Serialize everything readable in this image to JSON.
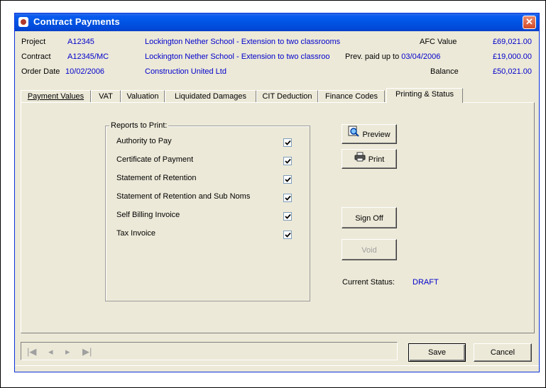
{
  "window": {
    "title": "Contract Payments",
    "close_glyph": "✕"
  },
  "header": {
    "project": {
      "label": "Project",
      "code": "A12345",
      "description": "Lockington Nether School - Extension to two classrooms",
      "value_label": "AFC Value",
      "value": "£69,021.00"
    },
    "contract": {
      "label": "Contract",
      "code": "A12345/MC",
      "description": "Lockington Nether School - Extension to two classroo",
      "value_label_prefix": "Prev. paid up to ",
      "value_label_date": "03/04/2006",
      "value": "£19,000.00"
    },
    "order": {
      "label": "Order Date",
      "date": "10/02/2006",
      "description": "Construction United Ltd",
      "value_label": "Balance",
      "value": "£50,021.00"
    }
  },
  "tabs": [
    {
      "label": "Payment Values",
      "active": false
    },
    {
      "label": "VAT",
      "active": false
    },
    {
      "label": "Valuation",
      "active": false
    },
    {
      "label": "Liquidated Damages",
      "active": false
    },
    {
      "label": "CIT Deduction",
      "active": false
    },
    {
      "label": "Finance Codes",
      "active": false
    },
    {
      "label": "Printing & Status",
      "active": true
    }
  ],
  "reports": {
    "group_label": "Reports to Print:",
    "items": [
      {
        "label": "Authority to Pay",
        "checked": true
      },
      {
        "label": "Certificate of Payment",
        "checked": true
      },
      {
        "label": "Statement of Retention",
        "checked": true
      },
      {
        "label": "Statement of Retention and Sub Noms",
        "checked": true
      },
      {
        "label": "Self Billing Invoice",
        "checked": true
      },
      {
        "label": "Tax Invoice",
        "checked": true
      }
    ]
  },
  "buttons": {
    "preview": "Preview",
    "print": "Print",
    "sign_off": "Sign Off",
    "void": "Void",
    "save": "Save",
    "cancel": "Cancel"
  },
  "status": {
    "label": "Current Status:",
    "value": "DRAFT"
  },
  "navigator": {
    "first": "|◀",
    "prev": "◂",
    "next": "▸",
    "last": "▶|"
  },
  "icons": [
    "app-icon",
    "close-icon",
    "preview-icon",
    "print-icon",
    "checkbox-check-icon"
  ],
  "colors": {
    "title_bar": "#0054e3",
    "link_text": "#0000cc",
    "face": "#ece9d8",
    "close": "#d24a26"
  }
}
